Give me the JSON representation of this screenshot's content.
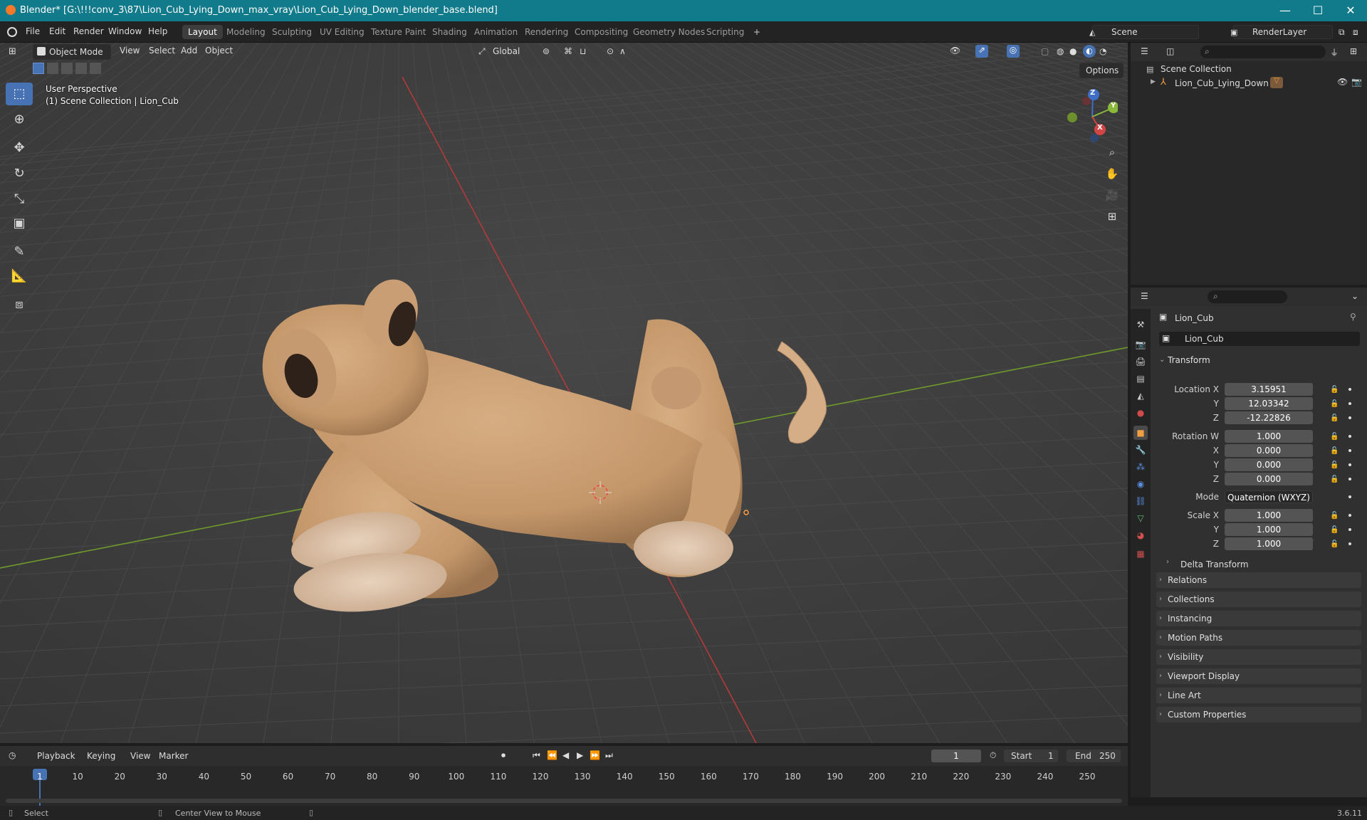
{
  "window": {
    "title": "Blender* [G:\\!!!conv_3\\87\\Lion_Cub_Lying_Down_max_vray\\Lion_Cub_Lying_Down_blender_base.blend]",
    "minimize": "—",
    "maximize": "☐",
    "close": "✕"
  },
  "menu": [
    "File",
    "Edit",
    "Render",
    "Window",
    "Help"
  ],
  "workspaces": [
    "Layout",
    "Modeling",
    "Sculpting",
    "UV Editing",
    "Texture Paint",
    "Shading",
    "Animation",
    "Rendering",
    "Compositing",
    "Geometry Nodes",
    "Scripting"
  ],
  "workspace_add": "+",
  "scene": {
    "name": "Scene",
    "render_layer": "RenderLayer"
  },
  "viewport": {
    "mode": "Object Mode",
    "menus": [
      "View",
      "Select",
      "Add",
      "Object"
    ],
    "transform_orientation": "Global",
    "options_label": "Options",
    "perspective_label": "User Perspective",
    "collection_label": "(1) Scene Collection | Lion_Cub",
    "gizmo_axes": {
      "z": "Z",
      "y": "Y",
      "x": "X"
    }
  },
  "outliner": {
    "root": "Scene Collection",
    "items": [
      {
        "name": "Lion_Cub_Lying_Down"
      }
    ]
  },
  "properties": {
    "object_name": "Lion_Cub",
    "data_name": "Lion_Cub",
    "transform_label": "Transform",
    "location": {
      "label": "Location X",
      "x": "3.15951",
      "y": "12.03342",
      "z": "-12.22826"
    },
    "rotation": {
      "label": "Rotation W",
      "w": "1.000",
      "x": "0.000",
      "y": "0.000",
      "z": "0.000"
    },
    "mode_label": "Mode",
    "mode_value": "Quaternion (WXYZ)",
    "scale": {
      "label": "Scale X",
      "x": "1.000",
      "y": "1.000",
      "z": "1.000"
    },
    "axis_labels": {
      "x": "X",
      "y": "Y",
      "z": "Z"
    },
    "delta_transform": "Delta Transform",
    "panels": [
      "Relations",
      "Collections",
      "Instancing",
      "Motion Paths",
      "Visibility",
      "Viewport Display",
      "Line Art",
      "Custom Properties"
    ]
  },
  "timeline": {
    "menus": [
      "Playback",
      "Keying",
      "View",
      "Marker"
    ],
    "current_frame": "1",
    "start_label": "Start",
    "start_value": "1",
    "end_label": "End",
    "end_value": "250",
    "ticks": [
      "1",
      "10",
      "20",
      "30",
      "40",
      "50",
      "60",
      "70",
      "80",
      "90",
      "100",
      "110",
      "120",
      "130",
      "140",
      "150",
      "160",
      "170",
      "180",
      "190",
      "200",
      "210",
      "220",
      "230",
      "240",
      "250"
    ]
  },
  "status": {
    "left": "Select",
    "middle": "Center View to Mouse",
    "version": "3.6.11"
  }
}
